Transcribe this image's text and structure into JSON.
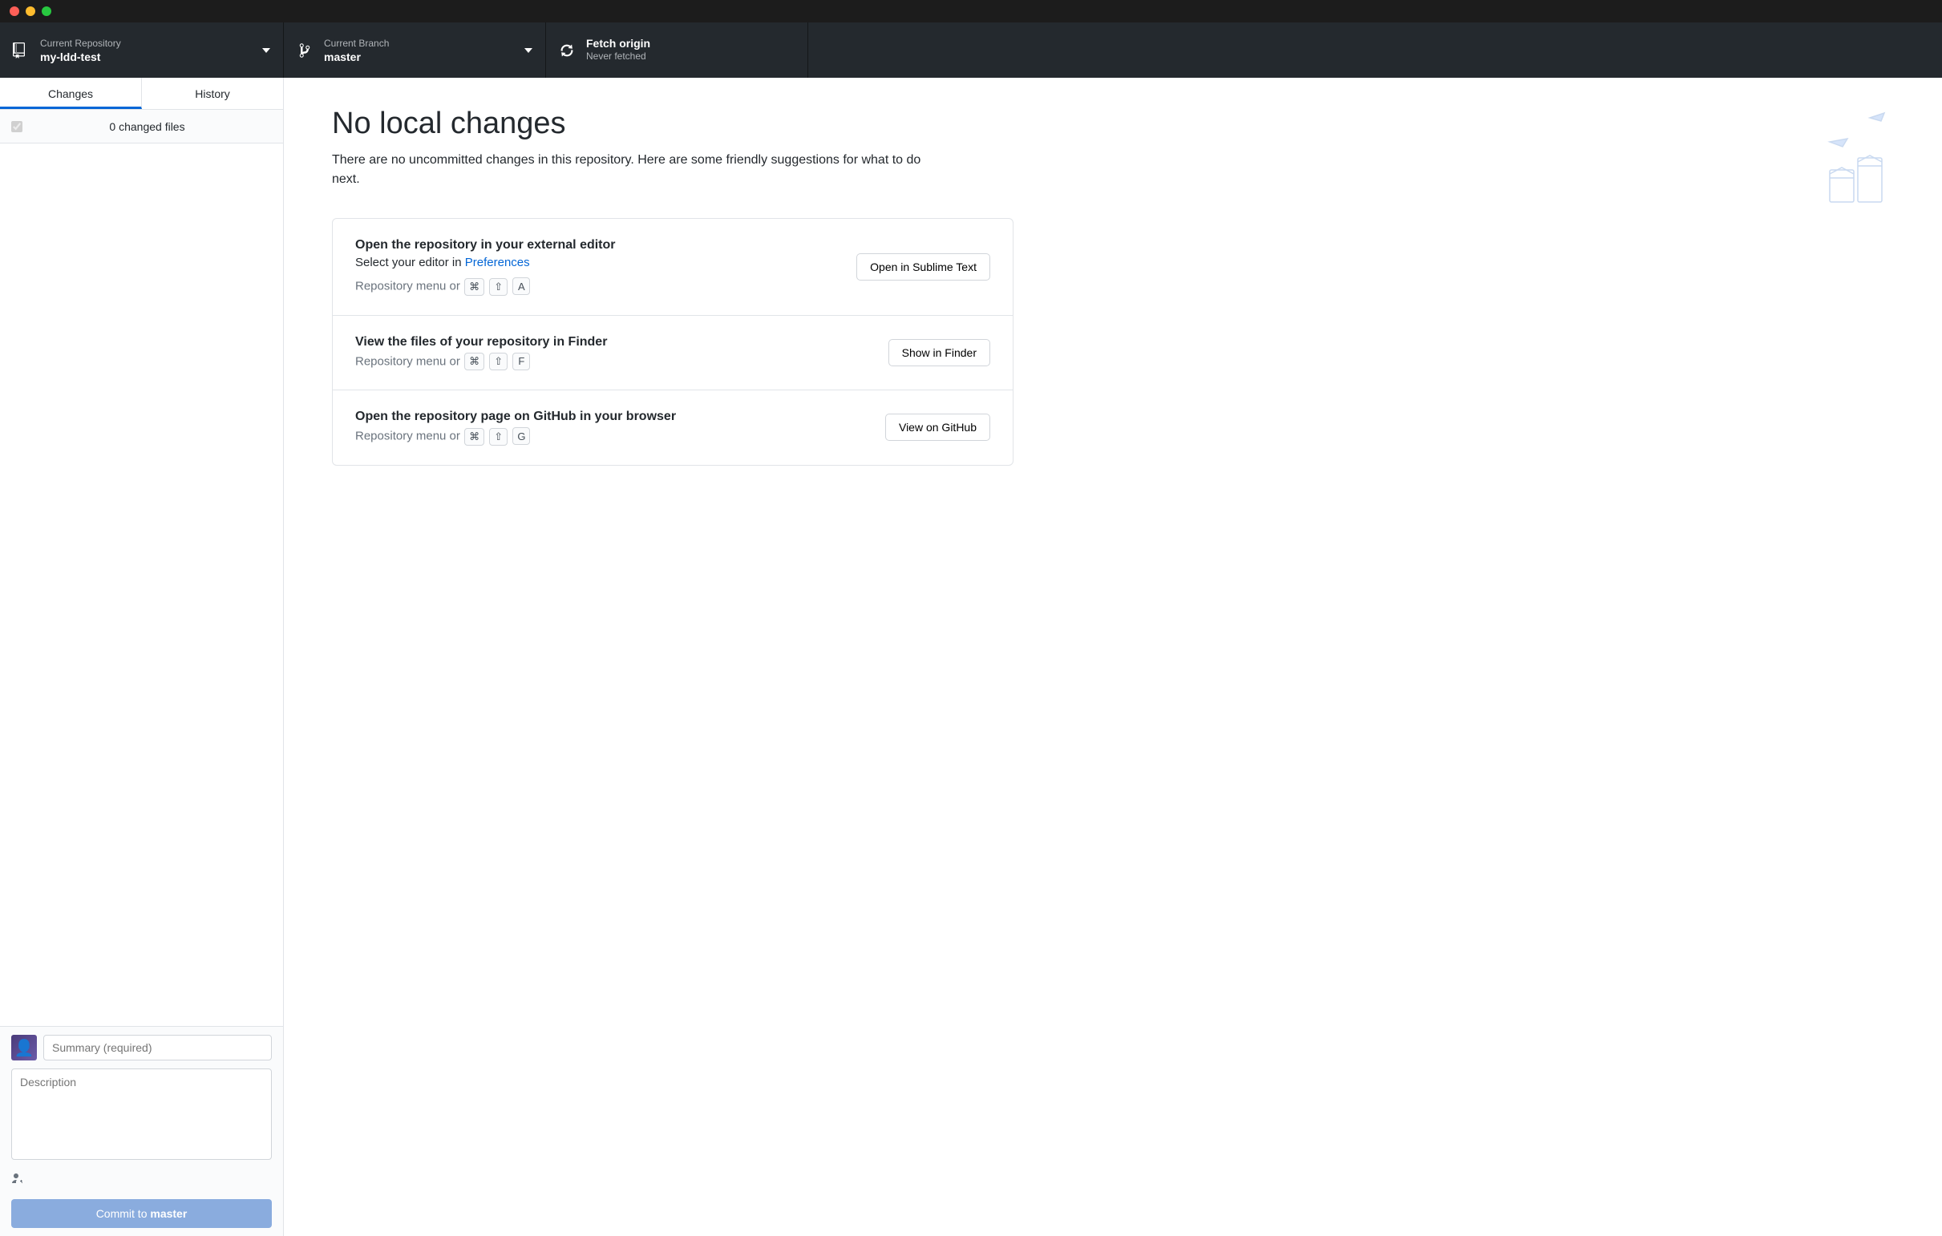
{
  "toolbar": {
    "repo": {
      "label": "Current Repository",
      "value": "my-ldd-test"
    },
    "branch": {
      "label": "Current Branch",
      "value": "master"
    },
    "fetch": {
      "label": "Fetch origin",
      "value": "Never fetched"
    }
  },
  "sidebar": {
    "tabs": {
      "changes": "Changes",
      "history": "History"
    },
    "changed_files": "0 changed files"
  },
  "commit_form": {
    "summary_placeholder": "Summary (required)",
    "description_placeholder": "Description",
    "button_prefix": "Commit to ",
    "button_branch": "master"
  },
  "main": {
    "heading": "No local changes",
    "subtitle": "There are no uncommitted changes in this repository. Here are some friendly suggestions for what to do next.",
    "suggestions": [
      {
        "title": "Open the repository in your external editor",
        "subtext": "Select your editor in ",
        "link": "Preferences",
        "hint_prefix": "Repository menu or ",
        "keys": [
          "⌘",
          "⇧",
          "A"
        ],
        "button": "Open in Sublime Text"
      },
      {
        "title": "View the files of your repository in Finder",
        "hint_prefix": "Repository menu or ",
        "keys": [
          "⌘",
          "⇧",
          "F"
        ],
        "button": "Show in Finder"
      },
      {
        "title": "Open the repository page on GitHub in your browser",
        "hint_prefix": "Repository menu or ",
        "keys": [
          "⌘",
          "⇧",
          "G"
        ],
        "button": "View on GitHub"
      }
    ]
  }
}
